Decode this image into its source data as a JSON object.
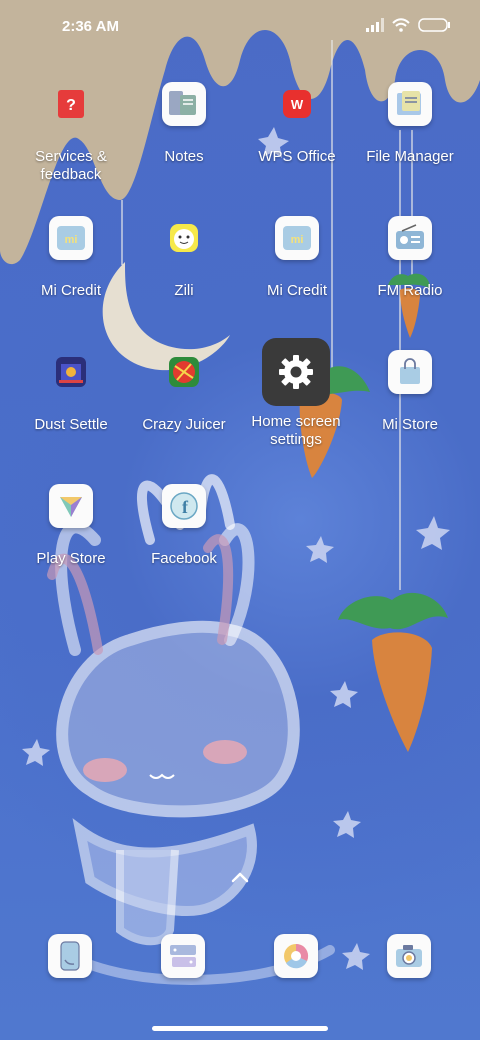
{
  "status": {
    "time": "2:36 AM"
  },
  "apps": [
    {
      "label": "Services &\nfeedback",
      "icon": "help-icon"
    },
    {
      "label": "Notes",
      "icon": "notes-icon"
    },
    {
      "label": "WPS Office",
      "icon": "wps-icon"
    },
    {
      "label": "File Manager",
      "icon": "folder-icon"
    },
    {
      "label": "Mi Credit",
      "icon": "mi-credit-icon"
    },
    {
      "label": "Zili",
      "icon": "zili-icon"
    },
    {
      "label": "Mi Credit",
      "icon": "mi-credit-icon"
    },
    {
      "label": "FM Radio",
      "icon": "radio-icon"
    },
    {
      "label": "Dust Settle",
      "icon": "game-icon"
    },
    {
      "label": "Crazy Juicer",
      "icon": "fruit-icon"
    },
    {
      "label": "Home screen settings",
      "icon": "gear-icon"
    },
    {
      "label": "Mi Store",
      "icon": "store-bag-icon"
    },
    {
      "label": "Play Store",
      "icon": "play-store-icon"
    },
    {
      "label": "Facebook",
      "icon": "facebook-icon"
    }
  ],
  "dock": [
    "phone-icon",
    "messages-icon",
    "browser-icon",
    "camera-icon"
  ],
  "colors": {
    "wallpaper": "#4a6dc8",
    "drip": "#c9b89a",
    "settings_tile": "#3a3a3a"
  }
}
